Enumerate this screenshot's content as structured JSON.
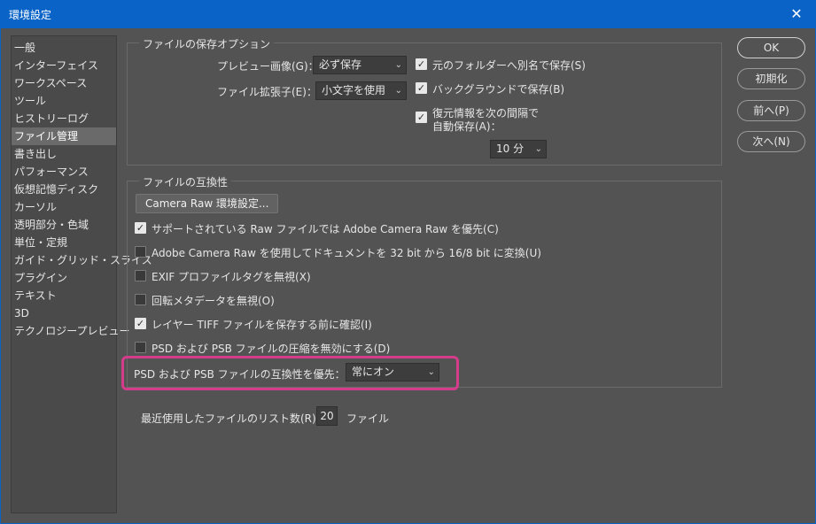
{
  "window": {
    "title": "環境設定",
    "close_glyph": "✕"
  },
  "sidebar": {
    "items": [
      {
        "label": "一般"
      },
      {
        "label": "インターフェイス"
      },
      {
        "label": "ワークスペース"
      },
      {
        "label": "ツール"
      },
      {
        "label": "ヒストリーログ"
      },
      {
        "label": "ファイル管理",
        "selected": true
      },
      {
        "label": "書き出し"
      },
      {
        "label": "パフォーマンス"
      },
      {
        "label": "仮想記憶ディスク"
      },
      {
        "label": "カーソル"
      },
      {
        "label": "透明部分・色域"
      },
      {
        "label": "単位・定規"
      },
      {
        "label": "ガイド・グリッド・スライス"
      },
      {
        "label": "プラグイン"
      },
      {
        "label": "テキスト"
      },
      {
        "label": "3D"
      },
      {
        "label": "テクノロジープレビュー"
      }
    ]
  },
  "save_options": {
    "title": "ファイルの保存オプション",
    "preview_label": "プレビュー画像(G)：",
    "preview_value": "必ず保存",
    "ext_label": "ファイル拡張子(E)：",
    "ext_value": "小文字を使用",
    "alias_label": "元のフォルダーへ別名で保存(S)",
    "alias_checked": true,
    "background_label": "バックグラウンドで保存(B)",
    "background_checked": true,
    "recover_label_1": "復元情報を次の間隔で",
    "recover_label_2": "自動保存(A)：",
    "recover_checked": true,
    "interval_value": "10 分"
  },
  "compat": {
    "title": "ファイルの互換性",
    "raw_button": "Camera Raw 環境設定...",
    "options": [
      {
        "label": "サポートされている Raw ファイルでは Adobe Camera Raw を優先(C)",
        "checked": true
      },
      {
        "label": "Adobe Camera Raw を使用してドキュメントを 32 bit から 16/8 bit に変換(U)",
        "checked": false
      },
      {
        "label": "EXIF プロファイルタグを無視(X)",
        "checked": false
      },
      {
        "label": "回転メタデータを無視(O)",
        "checked": false
      },
      {
        "label": "レイヤー TIFF ファイルを保存する前に確認(I)",
        "checked": true
      },
      {
        "label": "PSD および PSB ファイルの圧縮を無効にする(D)",
        "checked": false
      }
    ],
    "maximize_label": "PSD および PSB ファイルの互換性を優先：",
    "maximize_value": "常にオン"
  },
  "recent": {
    "label": "最近使用したファイルのリスト数(R)：",
    "value": "20",
    "unit": "ファイル"
  },
  "buttons": {
    "ok": "OK",
    "reset": "初期化",
    "prev": "前へ(P)",
    "next": "次へ(N)"
  },
  "colors": {
    "titlebar": "#0a64c8",
    "background": "#535353",
    "highlight": "#d63c8c"
  }
}
